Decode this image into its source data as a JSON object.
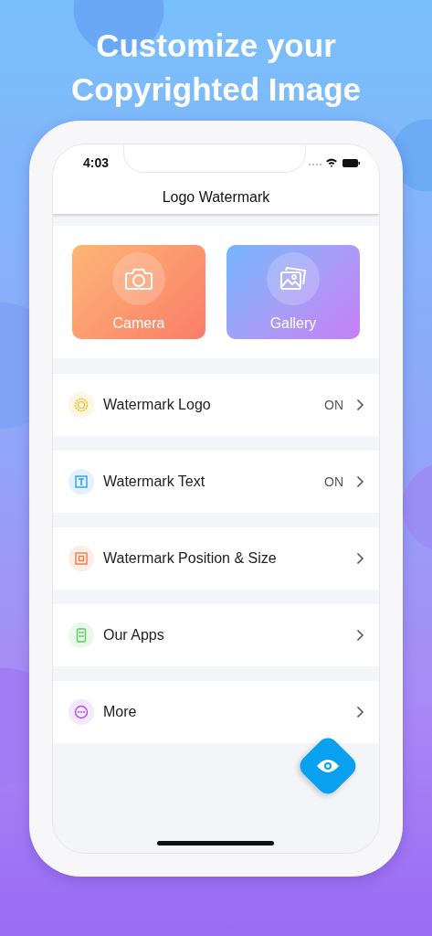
{
  "headline": [
    "Customize your",
    "Copyrighted Image"
  ],
  "status_bar": {
    "time": "4:03"
  },
  "screen_title": "Logo Watermark",
  "actions": [
    {
      "label": "Camera",
      "kind": "camera"
    },
    {
      "label": "Gallery",
      "kind": "gallery"
    }
  ],
  "menu": [
    {
      "label": "Watermark Logo",
      "status": "ON",
      "kind": "badge"
    },
    {
      "label": "Watermark Text",
      "status": "ON",
      "kind": "text"
    },
    {
      "label": "Watermark Position & Size",
      "kind": "position"
    },
    {
      "label": "Our Apps",
      "kind": "apps"
    },
    {
      "label": "More",
      "kind": "more"
    }
  ]
}
